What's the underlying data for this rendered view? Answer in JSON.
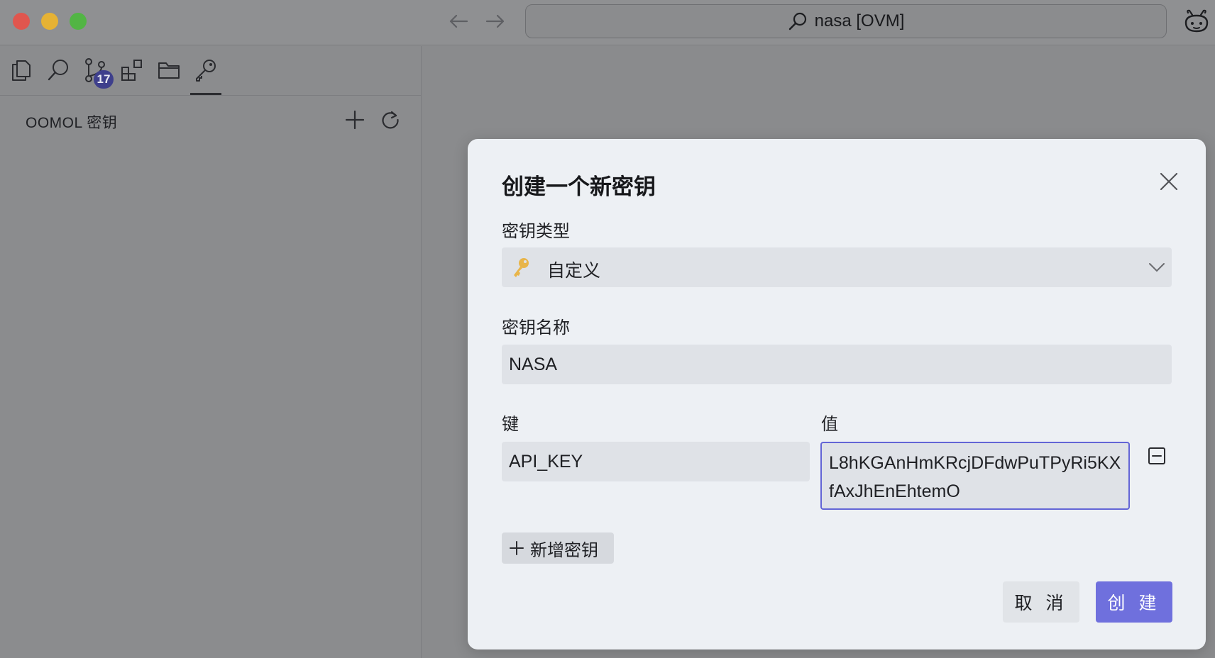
{
  "window": {
    "address_text": "nasa [OVM]",
    "icons": {
      "back": "arrow-left-icon",
      "forward": "arrow-right-icon",
      "search": "search-icon",
      "app": "app-logo-icon"
    }
  },
  "activity_bar": {
    "items": [
      {
        "icon": "files-icon"
      },
      {
        "icon": "search-icon"
      },
      {
        "icon": "source-control-icon",
        "badge": "17"
      },
      {
        "icon": "extensions-icon"
      },
      {
        "icon": "folder-icon"
      },
      {
        "icon": "key-icon",
        "active": true
      }
    ]
  },
  "sidebar": {
    "title": "OOMOL 密钥"
  },
  "dialog": {
    "title": "创建一个新密钥",
    "type_label": "密钥类型",
    "type_value": "自定义",
    "name_label": "密钥名称",
    "name_value": "NASA",
    "key_label": "键",
    "value_label": "值",
    "key_value": "API_KEY",
    "value_value": "L8hKGAnHmKRcjDFdwPuTPyRi5KXfAxJhEnEhtemO",
    "add_secret_label": "新增密钥",
    "cancel_label": "取 消",
    "create_label": "创 建"
  },
  "colors": {
    "accent": "#6f70dd",
    "focus_border": "#6365d6",
    "key_icon": "#e8b54a",
    "badge": "#3e3f8c"
  }
}
